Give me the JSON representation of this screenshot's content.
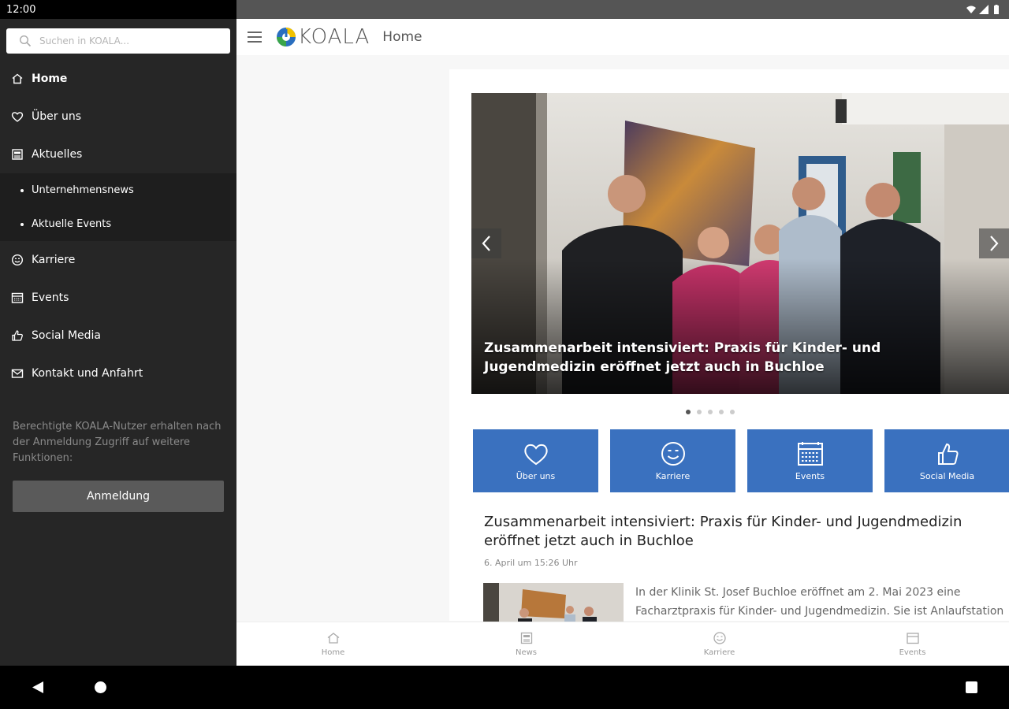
{
  "status_bar": {
    "time": "12:00"
  },
  "drawer": {
    "search": {
      "placeholder": "Suchen in KOALA..."
    },
    "items": [
      {
        "label": "Home",
        "icon": "home-icon",
        "active": true
      },
      {
        "label": "Über uns",
        "icon": "heart-icon"
      },
      {
        "label": "Aktuelles",
        "icon": "news-icon"
      }
    ],
    "subitems": [
      {
        "label": "Unternehmensnews"
      },
      {
        "label": "Aktuelle Events"
      }
    ],
    "items2": [
      {
        "label": "Karriere",
        "icon": "smiley-icon"
      },
      {
        "label": "Events",
        "icon": "calendar-icon"
      },
      {
        "label": "Social Media",
        "icon": "thumbs-up-icon"
      },
      {
        "label": "Kontakt und Anfahrt",
        "icon": "mail-icon"
      }
    ],
    "note": "Berechtigte KOALA-Nutzer erhalten nach der Anmeldung Zugriff auf weitere Funktionen:",
    "login_label": "Anmeldung"
  },
  "appbar": {
    "logo_text": "KOALA",
    "title": "Home"
  },
  "hero": {
    "caption": "Zusammenarbeit intensiviert: Praxis für Kinder- und Jugendmedizin eröffnet jetzt auch in Buchloe",
    "slide_count": 5,
    "active_slide": 0
  },
  "tiles": [
    {
      "label": "Über uns",
      "icon": "heart-icon"
    },
    {
      "label": "Karriere",
      "icon": "smiley-icon"
    },
    {
      "label": "Events",
      "icon": "calendar-icon"
    },
    {
      "label": "Social Media",
      "icon": "thumbs-up-icon"
    }
  ],
  "article": {
    "title": "Zusammenarbeit intensiviert: Praxis für Kinder- und Jugendmedizin eröffnet jetzt auch in Buchloe",
    "date": "6. April um 15:26 Uhr",
    "excerpt": "In der Klinik St. Josef Buchloe eröffnet am 2. Mai 2023 eine Facharztpraxis für Kinder- und Jugendmedizin. Sie ist Anlaufstation"
  },
  "bottom_nav": [
    {
      "label": "Home",
      "icon": "home-icon"
    },
    {
      "label": "News",
      "icon": "news-icon"
    },
    {
      "label": "Karriere",
      "icon": "smiley-icon"
    },
    {
      "label": "Events",
      "icon": "calendar-icon"
    }
  ],
  "colors": {
    "accent": "#3a71bf",
    "drawer_bg": "#262626"
  }
}
